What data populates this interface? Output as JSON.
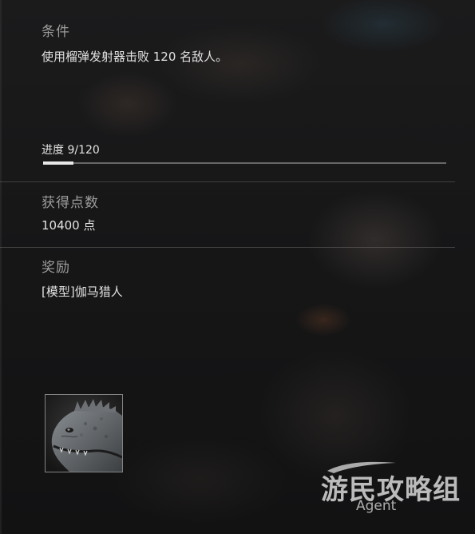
{
  "condition": {
    "heading": "条件",
    "text": "使用榴弹发射器击败 120 名敌人。"
  },
  "progress": {
    "label": "进度 9/120",
    "current": 9,
    "total": 120,
    "fraction": 0.075
  },
  "points": {
    "heading": "获得点数",
    "value": "10400 点"
  },
  "reward": {
    "heading": "奖励",
    "item": "[模型]伽马猎人",
    "thumbnail_icon": "gamma-hunter-model-icon"
  },
  "watermark": {
    "main": "游民攻略组",
    "sub": "Agent"
  }
}
